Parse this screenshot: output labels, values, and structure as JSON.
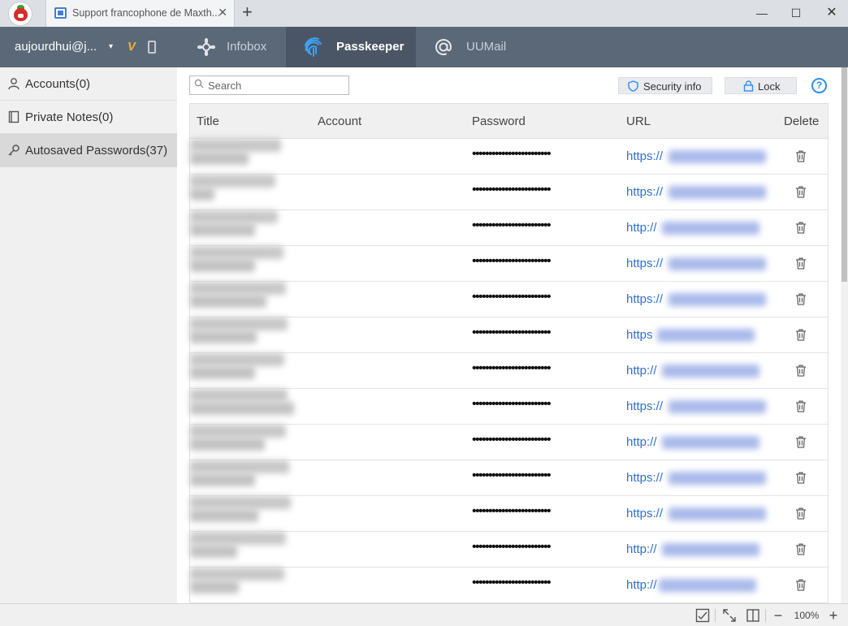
{
  "browser": {
    "tab_title": "Support francophone de Maxth...",
    "tab_close": "✕",
    "new_tab": "+",
    "window_controls": {
      "minimize": "—",
      "maximize": "☐",
      "close": "✕"
    }
  },
  "nav": {
    "user": "aujourdhui@j...",
    "caret": "▾",
    "vip": "V",
    "tabs": [
      {
        "label": "Infobox",
        "icon": "infobox-icon"
      },
      {
        "label": "Passkeeper",
        "icon": "fingerprint-icon",
        "active": true
      },
      {
        "label": "UUMail",
        "icon": "at-mail-icon"
      }
    ]
  },
  "sidebar": {
    "items": [
      {
        "label": "Accounts(0)",
        "icon": "user-icon"
      },
      {
        "label": "Private Notes(0)",
        "icon": "notebook-icon"
      },
      {
        "label": "Autosaved Passwords(37)",
        "icon": "key-icon",
        "selected": true
      }
    ]
  },
  "toolbar": {
    "search_placeholder": "Search",
    "security_label": "Security info",
    "lock_label": "Lock",
    "help_label": "?"
  },
  "table": {
    "headers": {
      "title": "Title",
      "account": "Account",
      "password": "Password",
      "url": "URL",
      "delete": "Delete"
    },
    "rows": [
      {
        "password": "••••••••••••••••••••••••",
        "url": "https://"
      },
      {
        "password": "••••••••••••••••••••••••",
        "url": "https://"
      },
      {
        "password": "••••••••••••••••••••••••",
        "url": "http://"
      },
      {
        "password": "••••••••••••••••••••••••",
        "url": "https://"
      },
      {
        "password": "••••••••••••••••••••••••",
        "url": "https://"
      },
      {
        "password": "••••••••••••••••••••••••",
        "url": "https"
      },
      {
        "password": "••••••••••••••••••••••••",
        "url": "http://"
      },
      {
        "password": "••••••••••••••••••••••••",
        "url": "https://"
      },
      {
        "password": "••••••••••••••••••••••••",
        "url": "http://"
      },
      {
        "password": "••••••••••••••••••••••••",
        "url": "https://"
      },
      {
        "password": "••••••••••••••••••••••••",
        "url": "https://"
      },
      {
        "password": "••••••••••••••••••••••••",
        "url": "http://"
      },
      {
        "password": "••••••••••••••••••••••••",
        "url": "http://"
      }
    ]
  },
  "statusbar": {
    "minus": "−",
    "zoom": "100%",
    "plus": "+"
  }
}
